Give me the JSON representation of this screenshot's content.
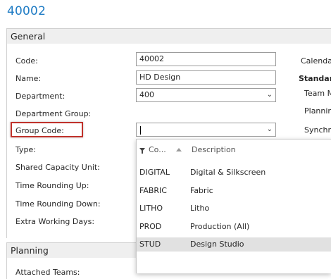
{
  "page": {
    "title": "40002"
  },
  "general": {
    "header": "General",
    "fields": {
      "code": {
        "label": "Code:",
        "value": "40002"
      },
      "name": {
        "label": "Name:",
        "value": "HD Design"
      },
      "department": {
        "label": "Department:",
        "value": "400"
      },
      "department_group": {
        "label": "Department Group:"
      },
      "group_code": {
        "label": "Group Code:",
        "value": ""
      },
      "type": {
        "label": "Type:"
      },
      "shared_capacity_unit": {
        "label": "Shared Capacity Unit:"
      },
      "time_rounding_up": {
        "label": "Time Rounding Up:"
      },
      "time_rounding_down": {
        "label": "Time Rounding Down:"
      },
      "extra_working_days": {
        "label": "Extra Working Days:"
      }
    },
    "right_column": {
      "calendar": "Calenda",
      "standard": "Standar",
      "team": "Team M",
      "planning": "Plannin",
      "synchro": "Synchro"
    }
  },
  "planning": {
    "header": "Planning",
    "attached_teams": "Attached Teams:"
  },
  "dropdown": {
    "columns": {
      "code": "Co...",
      "description": "Description"
    },
    "rows": [
      {
        "code": "DIGITAL",
        "description": "Digital & Silkscreen"
      },
      {
        "code": "FABRIC",
        "description": "Fabric"
      },
      {
        "code": "LITHO",
        "description": "Litho"
      },
      {
        "code": "PROD",
        "description": "Production (All)"
      },
      {
        "code": "STUD",
        "description": "Design Studio"
      }
    ],
    "selected_index": 4
  },
  "colors": {
    "title": "#1e7bc4",
    "highlight_border": "#c0312b",
    "selected_row": "#e1e1e1"
  }
}
